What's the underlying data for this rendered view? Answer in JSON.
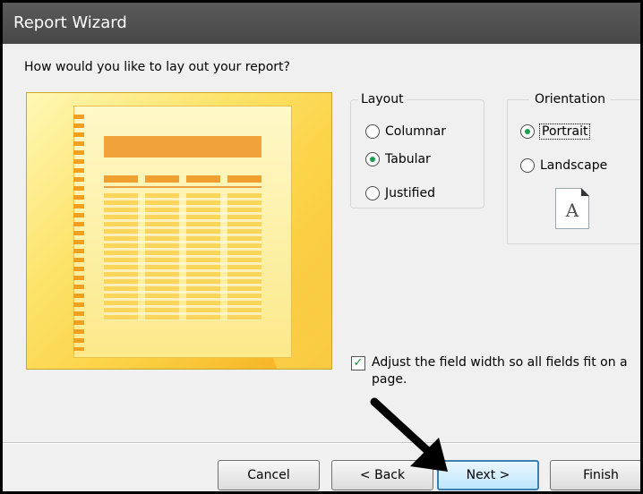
{
  "window": {
    "title": "Report Wizard"
  },
  "prompt": "How would you like to lay out your report?",
  "layout": {
    "legend": "Layout",
    "options": [
      {
        "label": "Columnar",
        "checked": false
      },
      {
        "label": "Tabular",
        "checked": true
      },
      {
        "label": "Justified",
        "checked": false
      }
    ]
  },
  "orientation": {
    "legend": "Orientation",
    "options": [
      {
        "label": "Portrait",
        "checked": true
      },
      {
        "label": "Landscape",
        "checked": false
      }
    ],
    "icon_letter": "A"
  },
  "adjust_width": {
    "label": "Adjust the field width so all fields fit on a page.",
    "checked": true
  },
  "buttons": {
    "cancel": "Cancel",
    "back": "< Back",
    "next": "Next >",
    "finish": "Finish"
  },
  "colors": {
    "titlebar": "#474747",
    "preview_accent": "#f2a23a",
    "radio_selected": "#19a04a",
    "default_button_border": "#3c7fb1",
    "annotation_arrow": "#000000"
  }
}
